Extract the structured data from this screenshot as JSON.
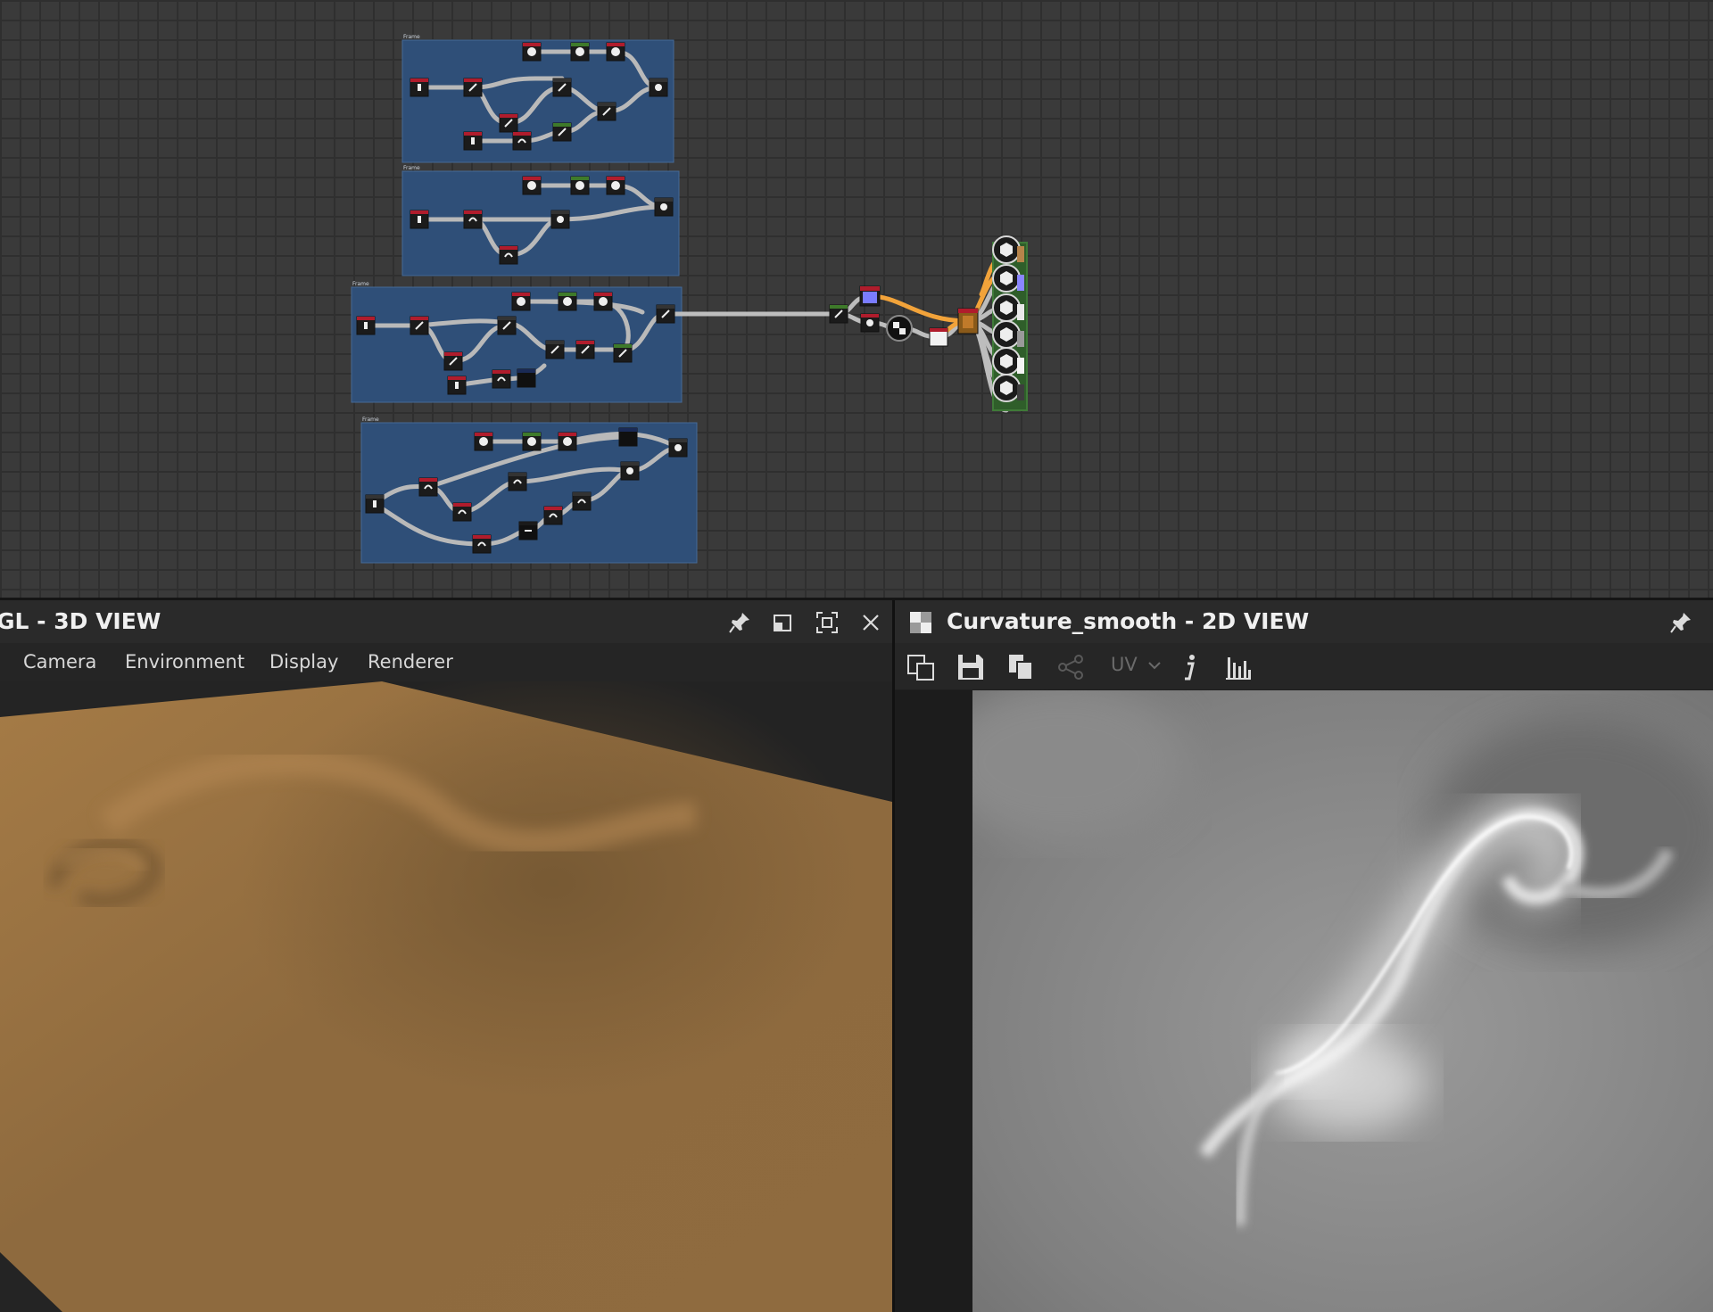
{
  "graph": {
    "frames": [
      {
        "label": "Frame"
      },
      {
        "label": "Frame"
      },
      {
        "label": "Frame"
      },
      {
        "label": "Frame"
      }
    ]
  },
  "view3d": {
    "title": "GL - 3D VIEW",
    "menu": [
      "Camera",
      "Environment",
      "Display",
      "Renderer"
    ],
    "icons": [
      "pin-icon",
      "float-window-icon",
      "maximize-icon",
      "close-icon"
    ]
  },
  "view2d": {
    "title": "Curvature_smooth - 2D VIEW",
    "toolbar": {
      "uv_label": "UV"
    },
    "icons": [
      "checker-icon",
      "pin-icon",
      "export-icon",
      "save-icon",
      "copy-icon",
      "share-icon",
      "chevron-down-icon",
      "info-icon",
      "histogram-icon"
    ]
  },
  "colors": {
    "frame_fill": "#2f4f78",
    "sand": "#8f6a3c",
    "link_orange": "#f2a33a"
  }
}
